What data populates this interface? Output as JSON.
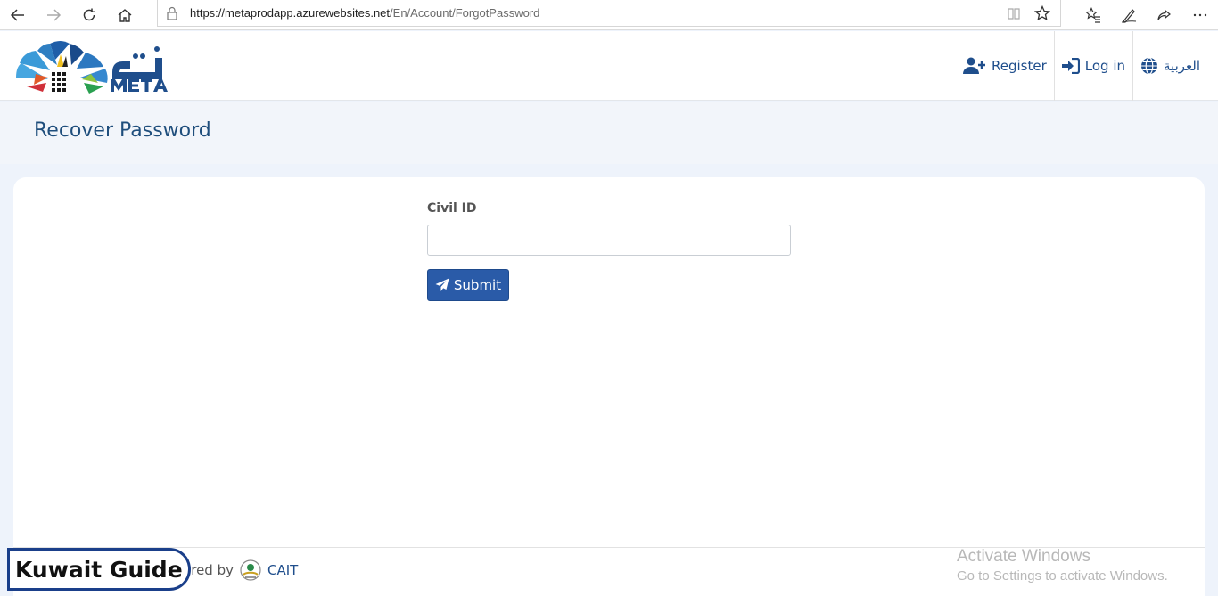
{
  "browser": {
    "url_host": "https://metaprodapp.azurewebsites.net",
    "url_path": "/En/Account/ForgotPassword"
  },
  "header": {
    "register_label": "Register",
    "login_label": "Log in",
    "language_label": "العربية"
  },
  "page": {
    "title": "Recover Password"
  },
  "form": {
    "civil_id_label": "Civil ID",
    "civil_id_value": "",
    "submit_label": "Submit"
  },
  "footer": {
    "powered_prefix": "ered by",
    "powered_brand": "CAIT"
  },
  "overlay": {
    "badge_text": "Kuwait Guide",
    "activate_title": "Activate Windows",
    "activate_subtitle": "Go to Settings to activate Windows."
  },
  "colors": {
    "brand_blue": "#1f4e8c",
    "button_blue": "#2a5ba8",
    "page_bg": "#eef3fb"
  }
}
